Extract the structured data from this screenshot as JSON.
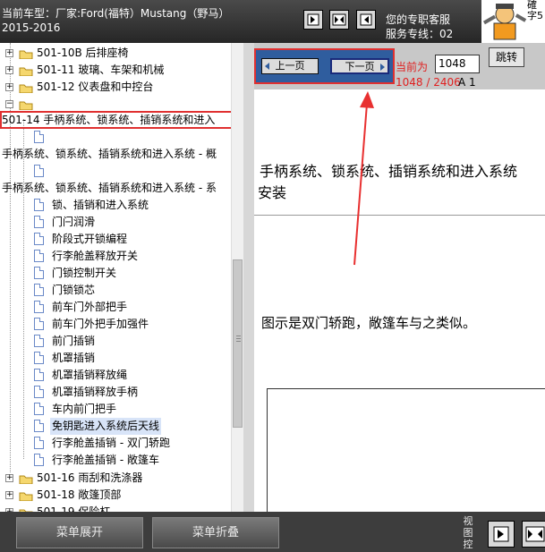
{
  "header": {
    "car_line1": "当前车型：厂家:Ford(福特）Mustang（野马）",
    "car_line2": "2015-2016",
    "service_line1": "您的专职客服",
    "service_line2": "服务专线：02",
    "ad_line1": "確",
    "ad_line2": "字5"
  },
  "tree": {
    "items": [
      {
        "label": "501-10B 后排座椅"
      },
      {
        "label": "501-11 玻璃、车架和机械"
      },
      {
        "label": "501-12 仪表盘和中控台"
      },
      {
        "label": ""
      },
      {
        "label": "501-14 手柄系统、锁系统、插销系统和进入"
      },
      {
        "label": ""
      },
      {
        "label": "手柄系统、锁系统、插销系统和进入系统 - 概"
      },
      {
        "label": ""
      },
      {
        "label": "手柄系统、锁系统、插销系统和进入系统 - 系"
      },
      {
        "label": "锁、插销和进入系统"
      },
      {
        "label": "门闩润滑"
      },
      {
        "label": "阶段式开锁编程"
      },
      {
        "label": "行李舱盖释放开关"
      },
      {
        "label": "门锁控制开关"
      },
      {
        "label": "门锁锁芯"
      },
      {
        "label": "前车门外部把手"
      },
      {
        "label": "前车门外把手加强件"
      },
      {
        "label": "前门插销"
      },
      {
        "label": "机罩插销"
      },
      {
        "label": "机罩插销释放绳"
      },
      {
        "label": "机罩插销释放手柄"
      },
      {
        "label": "车内前门把手"
      },
      {
        "label": "免钥匙进入系统后天线"
      },
      {
        "label": "行李舱盖插销 - 双门轿跑"
      },
      {
        "label": "行李舱盖插销 - 敞篷车"
      },
      {
        "label": "501-16 雨刮和洗涤器"
      },
      {
        "label": "501-18 敞篷顶部"
      },
      {
        "label": "501-19 保险杠"
      }
    ]
  },
  "nav": {
    "prev_label": "上一页",
    "next_label": "下一页",
    "current_label": "当前为",
    "page_value": "1048",
    "jump_label": "跳转",
    "page_count": "1048 / 2406",
    "page_size": "A 1"
  },
  "document": {
    "title": "手柄系统、锁系统、插销系统和进入系统",
    "subtitle": "安装",
    "note": "图示是双门轿跑，敞篷车与之类似。"
  },
  "bottom": {
    "expand_label": "菜单展开",
    "collapse_label": "菜单折叠",
    "view_label": "视图控"
  },
  "colors": {
    "highlight_box": "#e03030",
    "nav_bg": "#2f5d9e",
    "page_text": "#e02020"
  }
}
